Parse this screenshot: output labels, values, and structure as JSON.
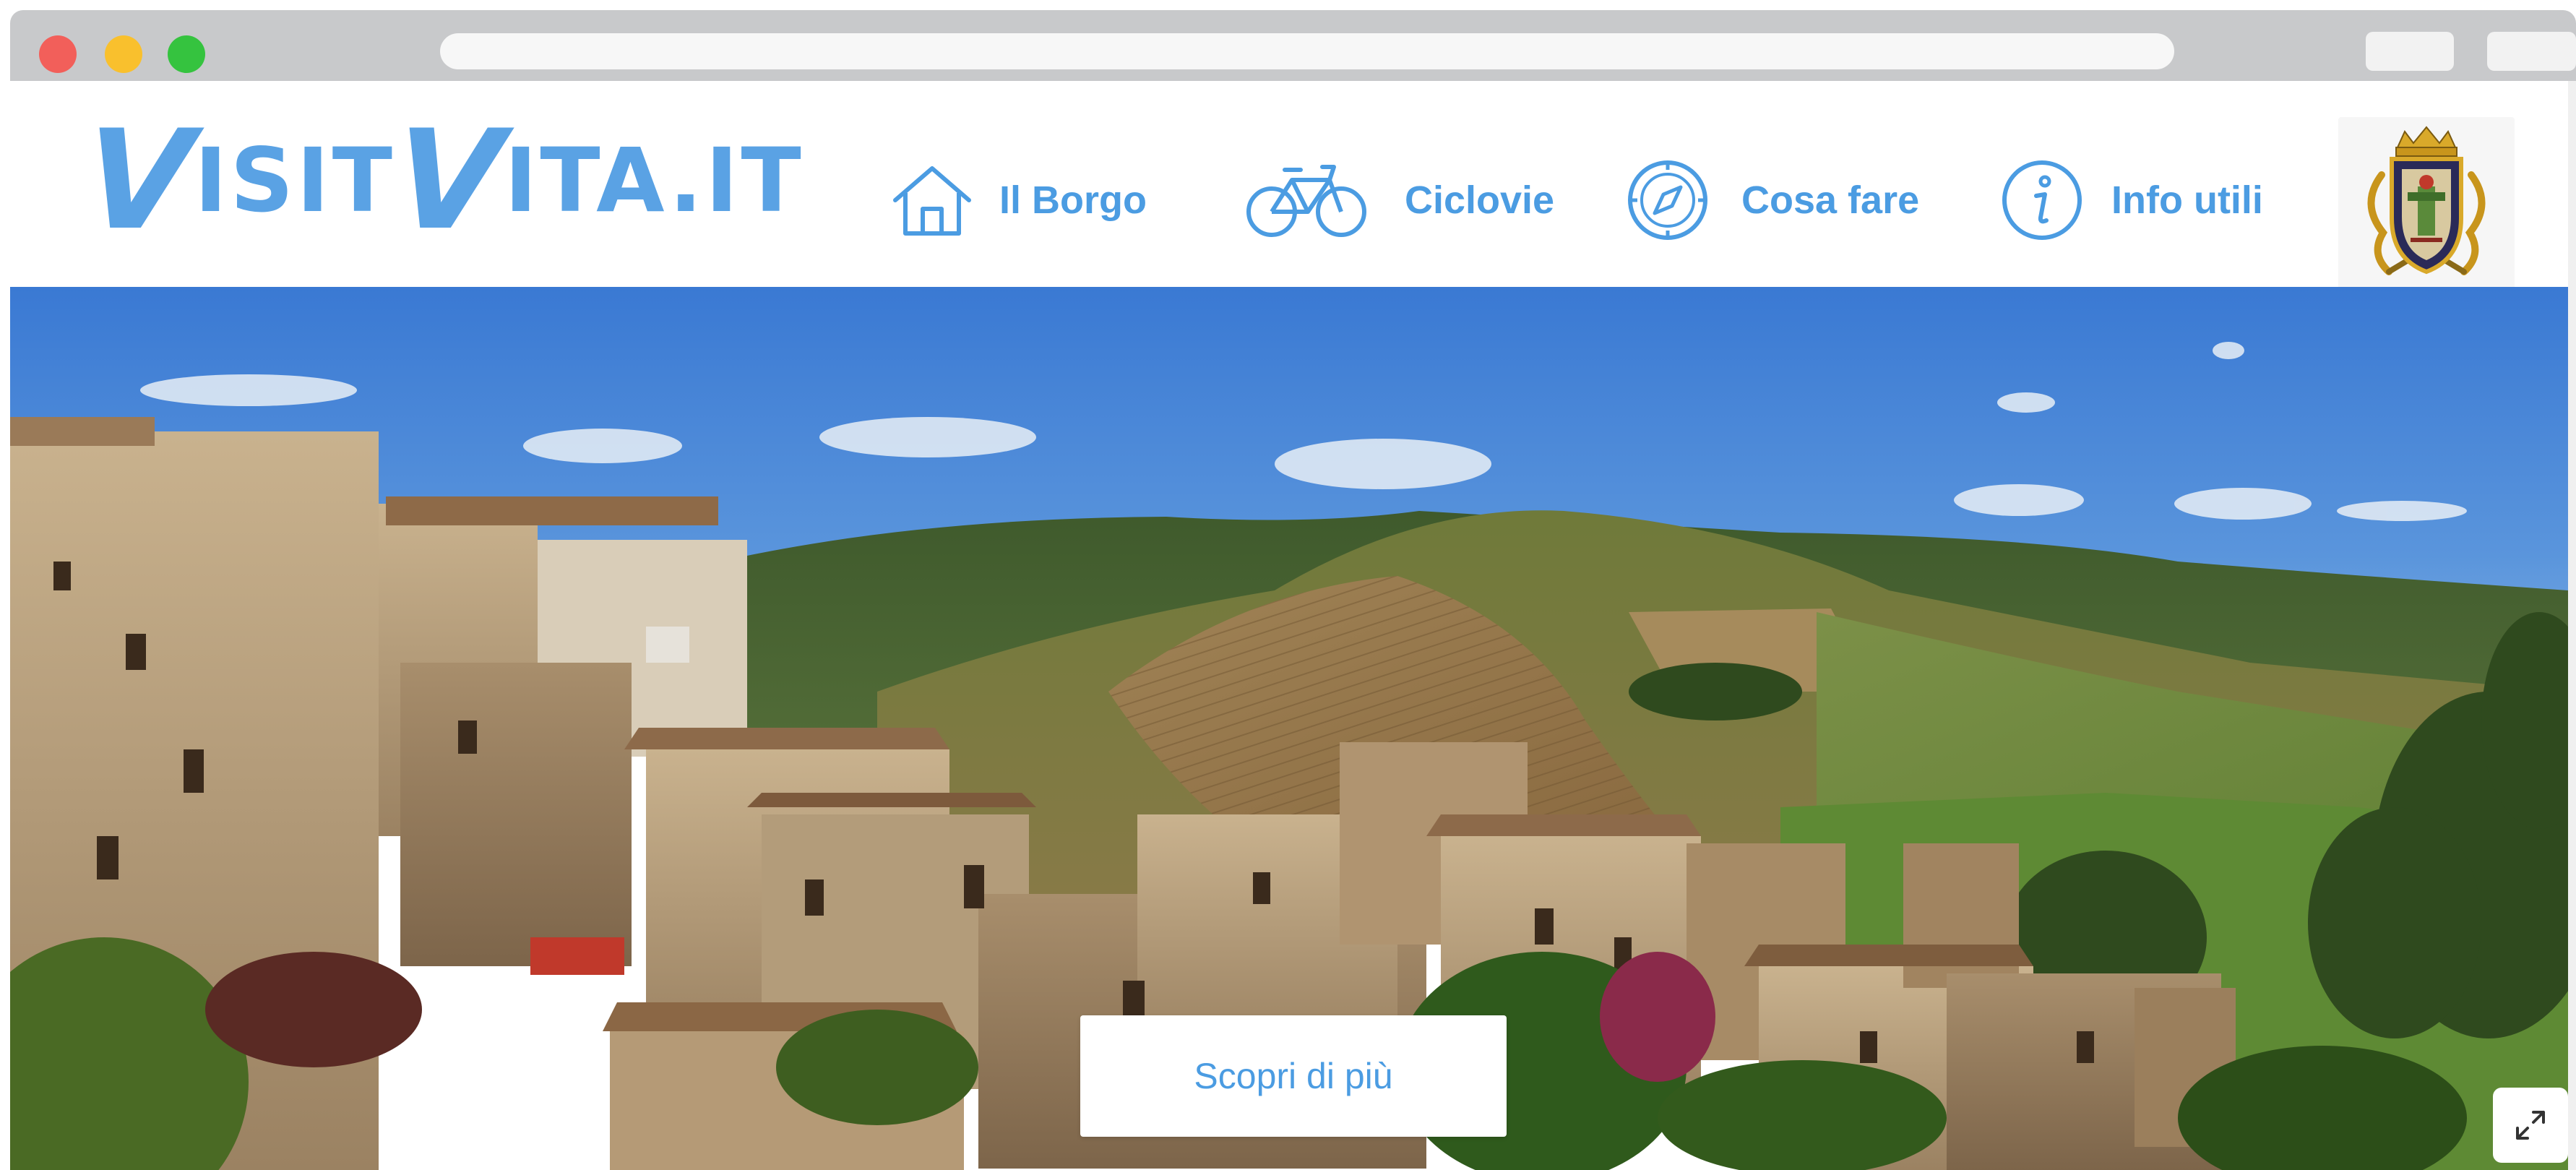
{
  "site": {
    "logo_part1": "V",
    "logo_part2": "ISIT",
    "logo_part3": "V",
    "logo_part4": "ITA.IT"
  },
  "nav": {
    "items": [
      {
        "label": "Il Borgo",
        "icon": "house-icon"
      },
      {
        "label": "Ciclovie",
        "icon": "bicycle-icon"
      },
      {
        "label": "Cosa fare",
        "icon": "compass-icon"
      },
      {
        "label": "Info utili",
        "icon": "info-icon"
      }
    ]
  },
  "hero": {
    "cta_label": "Scopri di più"
  },
  "colors": {
    "brand_blue": "#4b9ce2",
    "logo_blue": "#5aa2e4",
    "chrome_gray": "#c8c9cb",
    "sky": "#3f7fd6"
  },
  "icons": {
    "expand": "expand-icon",
    "crest": "coat-of-arms-icon"
  }
}
